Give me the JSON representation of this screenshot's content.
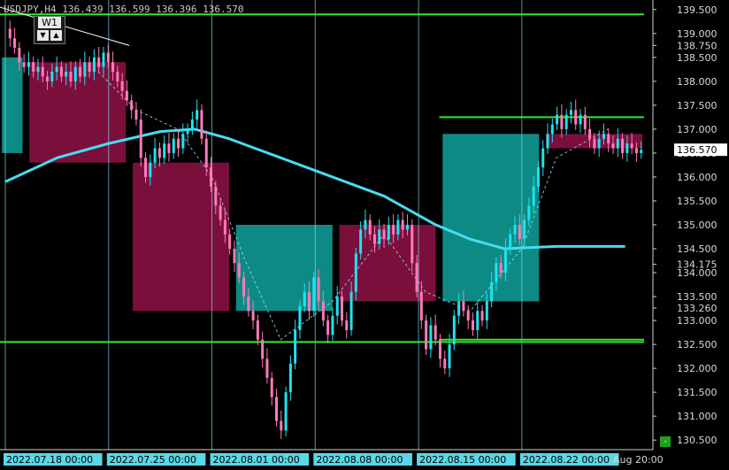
{
  "header": {
    "symbol_line": "USDJPY,H4  136.439 136.599 136.396 136.570",
    "timeframe": "W1",
    "arrow_up": "▲",
    "arrow_down": "▼"
  },
  "colors": {
    "background": "#000000",
    "bull_candle": "#1ee3ef",
    "bear_candle": "#ff7ab8",
    "bull_zone": "#0e8a85",
    "bear_zone": "#7a0f3c",
    "level_line": "#2eea2e",
    "ma_line": "#47dcef",
    "grid": "#7fe9f2"
  },
  "chart_data": {
    "type": "candlestick",
    "symbol": "USDJPY",
    "timeframe": "H4",
    "ylim": [
      130.3,
      139.7
    ],
    "y_ticks": [
      {
        "label": "139.500",
        "value": 139.5
      },
      {
        "label": "139.000",
        "value": 139.0
      },
      {
        "label": "138.750",
        "value": 138.75
      },
      {
        "label": "138.500",
        "value": 138.5
      },
      {
        "label": "138.000",
        "value": 138.0
      },
      {
        "label": "137.500",
        "value": 137.5
      },
      {
        "label": "137.000",
        "value": 137.0
      },
      {
        "label": "136.500",
        "value": 136.5
      },
      {
        "label": "136.000",
        "value": 136.0
      },
      {
        "label": "135.500",
        "value": 135.5
      },
      {
        "label": "135.000",
        "value": 135.0
      },
      {
        "label": "134.500",
        "value": 134.5
      },
      {
        "label": "134.175",
        "value": 134.175
      },
      {
        "label": "134.000",
        "value": 134.0
      },
      {
        "label": "133.500",
        "value": 133.5
      },
      {
        "label": "133.260",
        "value": 133.26
      },
      {
        "label": "133.000",
        "value": 133.0
      },
      {
        "label": "132.500",
        "value": 132.5
      },
      {
        "label": "132.000",
        "value": 132.0
      },
      {
        "label": "131.500",
        "value": 131.5
      },
      {
        "label": "131.000",
        "value": 131.0
      },
      {
        "label": "130.500",
        "value": 130.5
      }
    ],
    "current_price_label": "136.570",
    "current_price": 136.57,
    "x_ticks": [
      {
        "label": "2022.07.18 00:00",
        "index": 0
      },
      {
        "label": "2022.07.25 00:00",
        "index": 30
      },
      {
        "label": "2022.08.01 00:00",
        "index": 60
      },
      {
        "label": "2022.08.08 00:00",
        "index": 90
      },
      {
        "label": "2022.08.15 00:00",
        "index": 120
      },
      {
        "label": "2022.08.22 00:00",
        "index": 150
      },
      {
        "label": "Aug 20:00",
        "index": 180
      }
    ],
    "levels": [
      139.4,
      132.55,
      132.6,
      137.25
    ],
    "zones": [
      {
        "kind": "bull",
        "i0": -1,
        "i1": 5,
        "top": 138.5,
        "bottom": 136.5
      },
      {
        "kind": "bear",
        "i0": 7,
        "i1": 35,
        "top": 138.4,
        "bottom": 136.3
      },
      {
        "kind": "bear",
        "i0": 37,
        "i1": 65,
        "top": 136.3,
        "bottom": 133.2
      },
      {
        "kind": "bull",
        "i0": 67,
        "i1": 95,
        "top": 135.0,
        "bottom": 133.2
      },
      {
        "kind": "bear",
        "i0": 97,
        "i1": 125,
        "top": 135.0,
        "bottom": 133.4
      },
      {
        "kind": "bull",
        "i0": 127,
        "i1": 155,
        "top": 136.9,
        "bottom": 133.4
      },
      {
        "kind": "bear",
        "i0": 157,
        "i1": 185,
        "top": 136.9,
        "bottom": 136.6
      }
    ],
    "moving_average": [
      {
        "i": 0,
        "v": 135.9
      },
      {
        "i": 15,
        "v": 136.4
      },
      {
        "i": 30,
        "v": 136.7
      },
      {
        "i": 45,
        "v": 136.95
      },
      {
        "i": 55,
        "v": 137.0
      },
      {
        "i": 65,
        "v": 136.8
      },
      {
        "i": 80,
        "v": 136.4
      },
      {
        "i": 95,
        "v": 136.0
      },
      {
        "i": 110,
        "v": 135.6
      },
      {
        "i": 125,
        "v": 135.0
      },
      {
        "i": 135,
        "v": 134.7
      },
      {
        "i": 145,
        "v": 134.5
      },
      {
        "i": 160,
        "v": 134.55
      },
      {
        "i": 180,
        "v": 134.55
      }
    ],
    "closes": [
      139.1,
      138.9,
      138.7,
      138.4,
      138.3,
      138.4,
      138.2,
      138.3,
      138.1,
      138.0,
      138.2,
      138.3,
      138.1,
      138.2,
      138.0,
      138.3,
      138.1,
      138.4,
      138.2,
      138.5,
      138.3,
      138.6,
      138.4,
      138.2,
      138.0,
      137.8,
      137.6,
      137.4,
      137.2,
      136.4,
      136.0,
      136.3,
      136.6,
      136.4,
      136.7,
      136.5,
      136.8,
      136.6,
      136.9,
      137.0,
      137.2,
      137.4,
      136.8,
      136.2,
      135.8,
      135.4,
      135.1,
      134.8,
      134.5,
      134.2,
      133.9,
      133.5,
      133.2,
      133.0,
      132.6,
      132.2,
      131.8,
      131.4,
      130.9,
      130.7,
      131.5,
      132.1,
      132.8,
      133.3,
      133.6,
      133.2,
      133.9,
      133.4,
      133.0,
      132.7,
      133.1,
      133.5,
      133.0,
      132.8,
      133.6,
      134.4,
      134.9,
      135.1,
      134.8,
      134.6,
      134.9,
      134.7,
      135.0,
      134.8,
      135.1,
      134.9,
      135.0,
      134.2,
      133.6,
      133.0,
      132.4,
      132.9,
      132.6,
      132.2,
      132.0,
      132.5,
      133.1,
      133.4,
      133.2,
      133.0,
      132.8,
      133.2,
      133.0,
      133.4,
      133.8,
      134.2,
      134.0,
      134.5,
      134.8,
      135.0,
      134.7,
      135.1,
      135.4,
      135.8,
      136.2,
      136.6,
      136.9,
      137.1,
      137.3,
      137.0,
      137.3,
      137.4,
      137.1,
      137.3,
      137.0,
      136.8,
      136.6,
      136.8,
      136.9,
      136.7,
      136.6,
      136.8,
      136.5,
      136.7,
      136.6,
      136.5,
      136.57
    ]
  }
}
